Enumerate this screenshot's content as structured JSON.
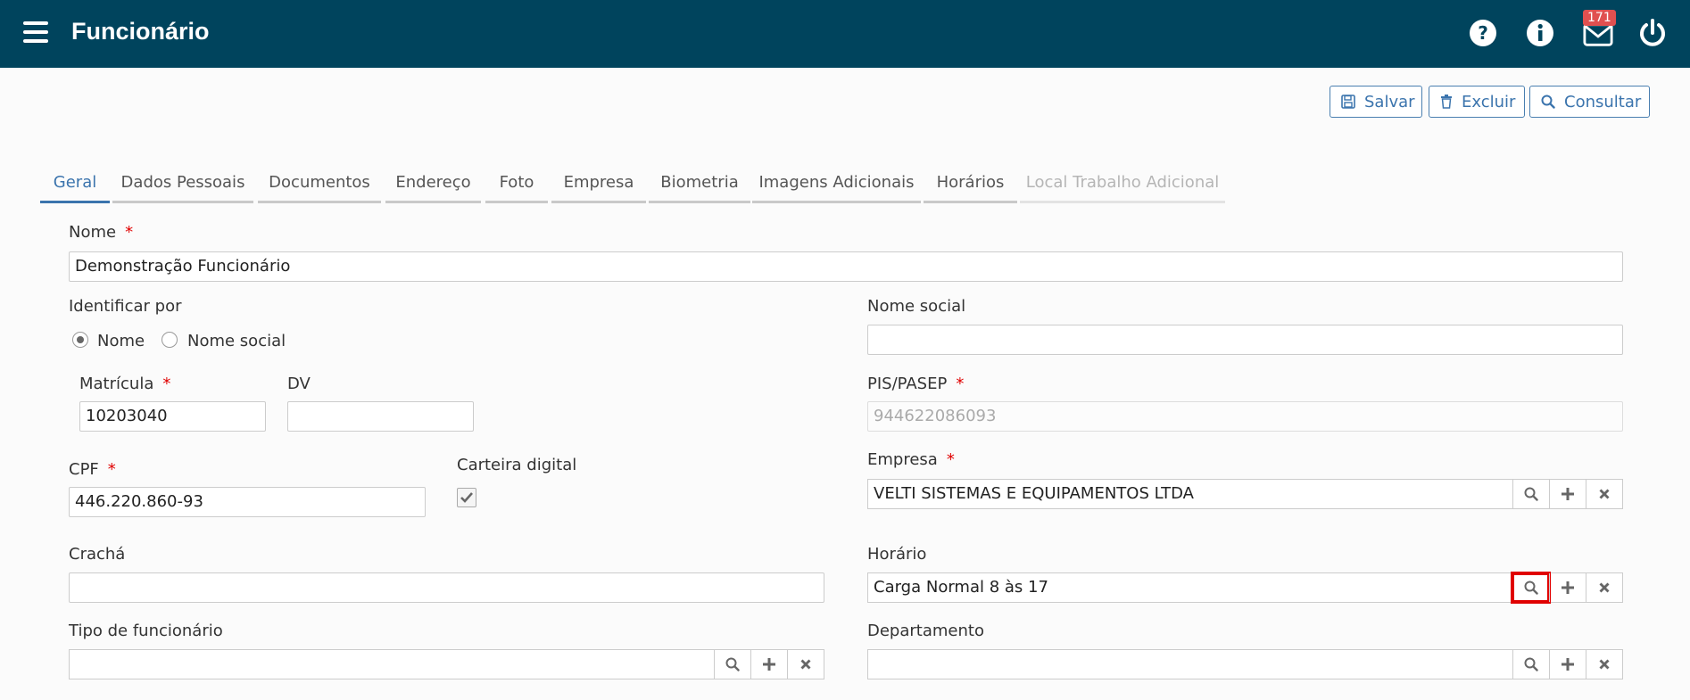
{
  "header": {
    "title": "Funcionário",
    "mail_badge": "171"
  },
  "toolbar": {
    "save_label": "Salvar",
    "delete_label": "Excluir",
    "query_label": "Consultar"
  },
  "tabs": [
    "Geral",
    "Dados Pessoais",
    "Documentos",
    "Endereço",
    "Foto",
    "Empresa",
    "Biometria",
    "Imagens Adicionais",
    "Horários",
    "Local Trabalho Adicional"
  ],
  "form": {
    "nome": {
      "label": "Nome",
      "value": "Demonstração Funcionário",
      "required": "*"
    },
    "identificar": {
      "label": "Identificar por",
      "option_nome": "Nome",
      "option_social": "Nome social",
      "selected": "Nome"
    },
    "nome_social": {
      "label": "Nome social",
      "value": ""
    },
    "matricula": {
      "label": "Matrícula",
      "value": "10203040",
      "required": "*"
    },
    "dv": {
      "label": "DV",
      "value": ""
    },
    "pis": {
      "label": "PIS/PASEP",
      "value": "944622086093",
      "required": "*"
    },
    "cpf": {
      "label": "CPF",
      "value": "446.220.860-93",
      "required": "*"
    },
    "carteira": {
      "label": "Carteira digital",
      "checked": true
    },
    "empresa": {
      "label": "Empresa",
      "value": "VELTI SISTEMAS E EQUIPAMENTOS LTDA",
      "required": "*"
    },
    "cracha": {
      "label": "Crachá",
      "value": ""
    },
    "horario": {
      "label": "Horário",
      "value": "Carga Normal 8 às 17"
    },
    "tipo": {
      "label": "Tipo de funcionário",
      "value": ""
    },
    "departamento": {
      "label": "Departamento",
      "value": ""
    }
  },
  "colors": {
    "header_bg": "#00445d",
    "accent": "#3b74ad",
    "required": "#e00000",
    "highlight": "#e00000"
  }
}
